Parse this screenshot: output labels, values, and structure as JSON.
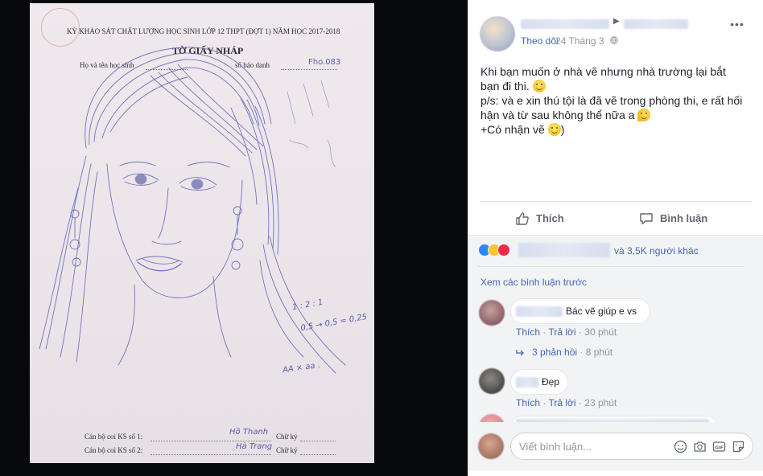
{
  "photo": {
    "exam_header": "KỲ KHẢO SÁT CHẤT LƯỢNG HỌC SINH LỚP 12 THPT (ĐỢT 1) NĂM HỌC 2017-2018",
    "sheet_title": "TỜ GIẤY NHÁP",
    "name_label": "Họ và tên học sinh",
    "sbd_label": "số báo danh",
    "sbd_value": "Fho.083",
    "math_note_1": "1 : 2 : 1",
    "math_note_2": "0,5 → 0,5 = 0,25",
    "math_note_3": "AA × aa .",
    "proctor_1_label": "Cán bộ coi KS số 1:",
    "proctor_2_label": "Cán bộ coi KS số 2:",
    "signature_label": "Chữ ký",
    "proctor_1_sig": "Hồ Thanh",
    "proctor_2_sig": "Hà Trang"
  },
  "post": {
    "follow_label": "Theo dõi",
    "separator": "·",
    "time": "24 Tháng 3",
    "more_label": "•••",
    "body": {
      "line1": "Khi bạn muốn ở nhà vẽ nhưng nhà trường lại bắt",
      "line2": "bạn đi thi.",
      "line3": "p/s: và e xin thú tội là đã vẽ trong phòng thi, e rất hối",
      "line4": "hận và từ sau không thể nữa a",
      "line5_a": "+Có nhận vẽ",
      "line5_b": ")"
    },
    "actions": {
      "like": "Thích",
      "comment": "Bình luận"
    },
    "reactions": {
      "others": "và 3,5K người khác"
    },
    "comments": {
      "view_previous": "Xem các bình luận trước",
      "items": [
        {
          "text": "Bác vẽ giúp e vs",
          "like": "Thích",
          "reply": "Trả lời",
          "time": "30 phút"
        },
        {
          "text": "Đẹp",
          "like": "Thích",
          "reply": "Trả lời",
          "time": "23 phút"
        }
      ],
      "replies_label": "3 phản hồi",
      "replies_time": "8 phút",
      "composer_placeholder": "Viết bình luận..."
    },
    "colors": {
      "link": "#4267b2",
      "meta": "#90949c",
      "like_reaction": "#2d88ff",
      "haha_reaction": "#f7c52c",
      "love_reaction": "#f0284a"
    },
    "icons": [
      "globe-icon",
      "more-icon",
      "thumbs-up-icon",
      "comment-icon",
      "reply-arrow-icon",
      "emoji-icon",
      "camera-icon",
      "gif-icon",
      "sticker-icon"
    ]
  }
}
